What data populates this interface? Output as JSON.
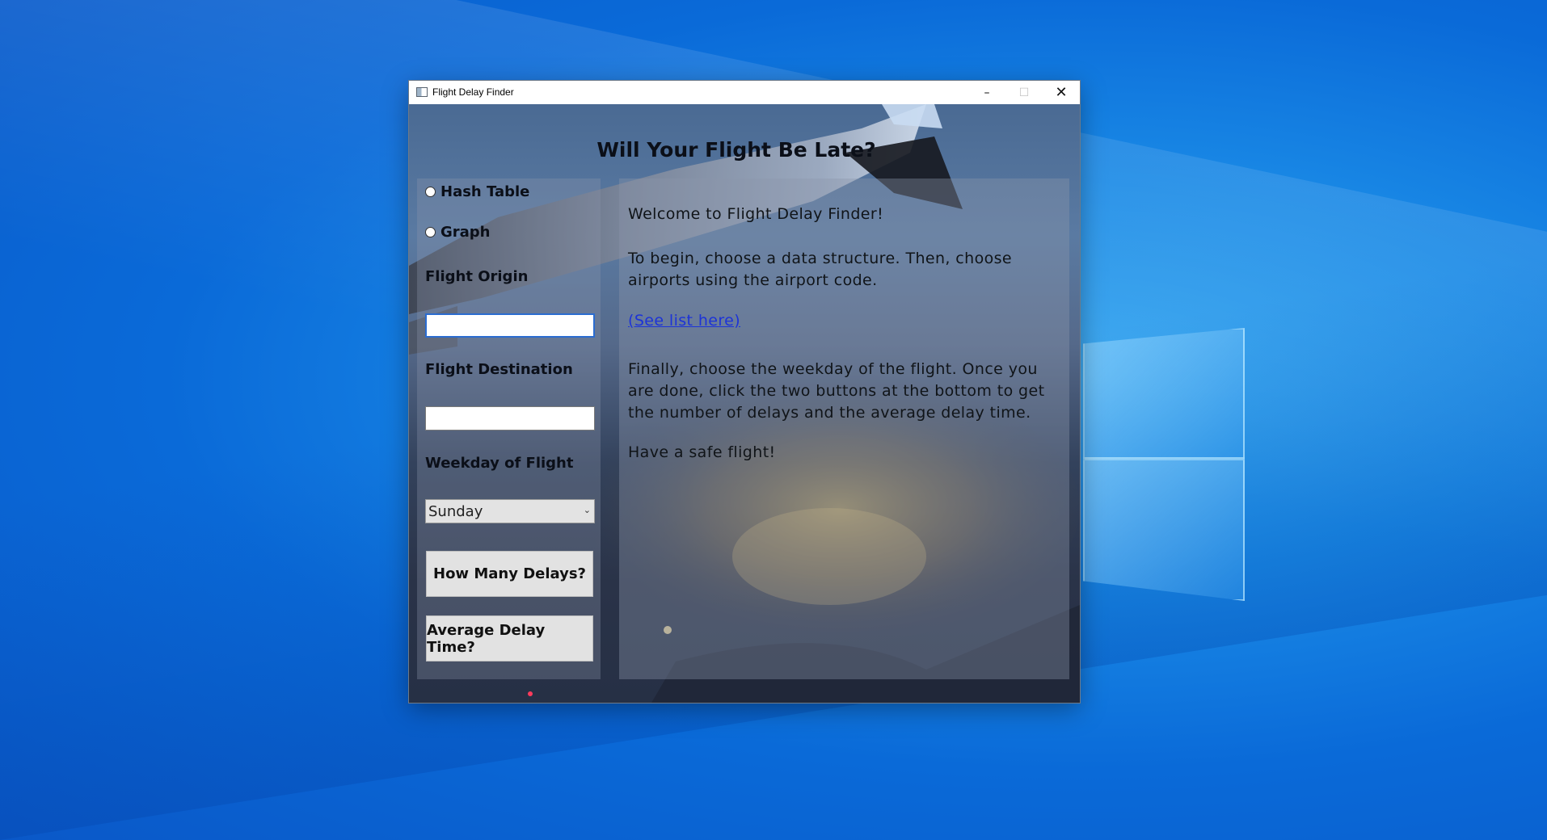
{
  "window": {
    "title": "Flight Delay Finder",
    "controls": {
      "minimize": "–",
      "maximize": "☐",
      "close": "✕"
    }
  },
  "heading": "Will Your Flight Be Late?",
  "data_structure": {
    "options": [
      {
        "label": "Hash Table",
        "selected": false
      },
      {
        "label": "Graph",
        "selected": false
      }
    ]
  },
  "form": {
    "origin_label": "Flight Origin",
    "origin_value": "",
    "destination_label": "Flight Destination",
    "destination_value": "",
    "weekday_label": "Weekday of Flight",
    "weekday_selected": "Sunday"
  },
  "buttons": {
    "delays": "How Many Delays?",
    "average": "Average Delay Time?"
  },
  "info": {
    "welcome": "Welcome to Flight Delay Finder!",
    "instructions": "To begin, choose a data structure. Then, choose airports using the airport code.",
    "link": "(See list here)",
    "finally": "Finally, choose the weekday of the flight. Once you are done, click the two buttons at the bottom to get the number of delays and the average delay time.",
    "safe": "Have a safe flight!"
  },
  "colors": {
    "desktop_blue": "#0a6ad8",
    "link_blue": "#1c33d8",
    "focus_border": "#2b6cd0"
  },
  "icons": [
    "app-window-icon",
    "minimize-icon",
    "maximize-icon",
    "close-icon",
    "chevron-down-icon",
    "windows-logo"
  ]
}
